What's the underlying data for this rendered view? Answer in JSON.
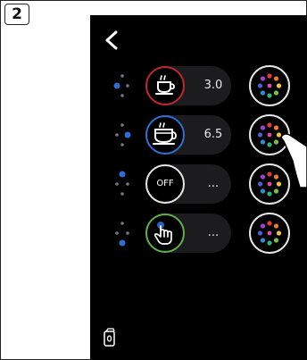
{
  "step": {
    "number": "2"
  },
  "colors": {
    "background": "#000000",
    "pill": "#1c1c1e",
    "ring_red": "#c0282e",
    "ring_blue": "#2f6fd6",
    "ring_white": "#e6e6e6",
    "ring_green": "#5fb04a",
    "dot_blue": "#2e6cd6"
  },
  "rows": [
    {
      "id": "A",
      "icon": "espresso-cup-icon",
      "ring": "red",
      "value": "3.0"
    },
    {
      "id": "B",
      "icon": "double-cup-icon",
      "ring": "blue",
      "value": "6.5"
    },
    {
      "id": "C",
      "icon": "off",
      "label": "OFF",
      "ring": "white",
      "value": "..."
    },
    {
      "id": "D",
      "icon": "hand-touch-icon",
      "ring": "green",
      "value": "..."
    }
  ],
  "icons": {
    "back": "chevron-left-icon",
    "color_picker": "color-wheel-icon",
    "logo": "machine-logo-icon",
    "pointer": "hand-pointer-icon"
  }
}
